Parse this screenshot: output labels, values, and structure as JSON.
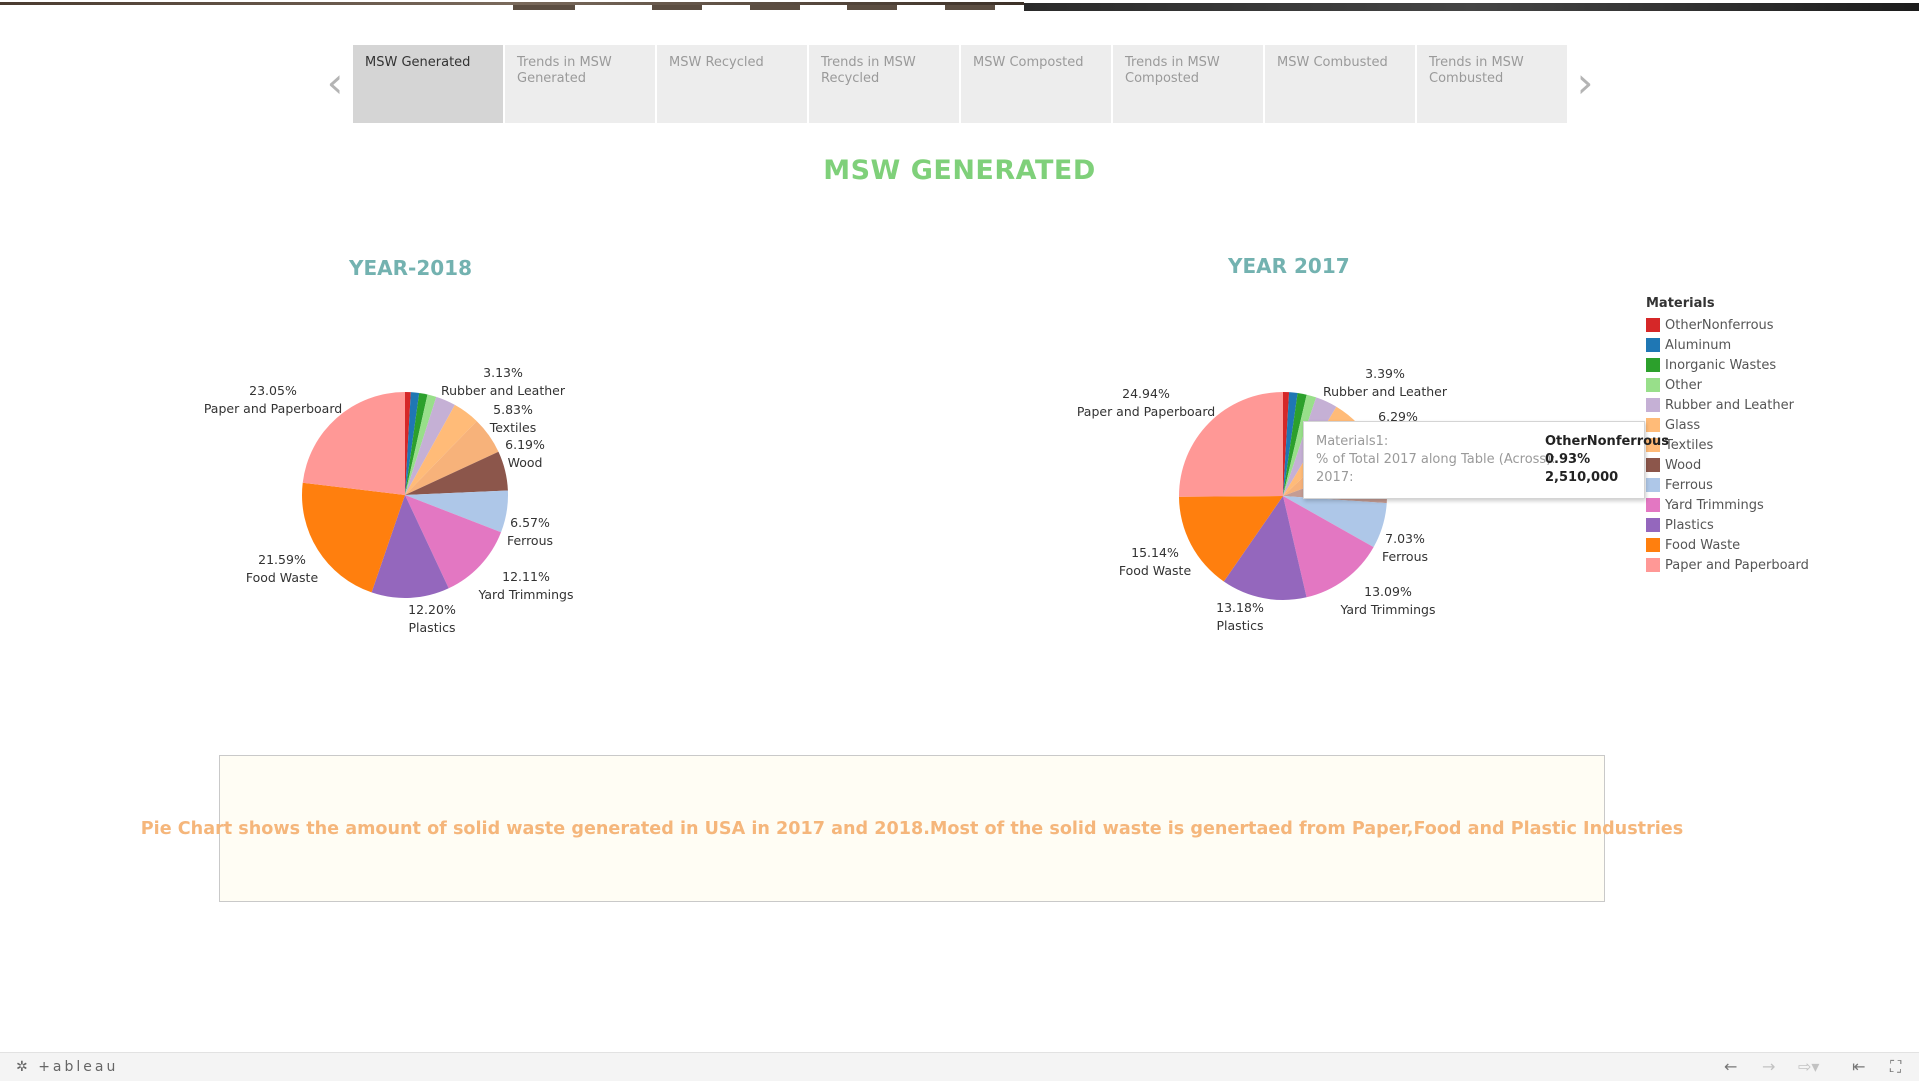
{
  "tabs": [
    {
      "label": "MSW Generated",
      "active": true
    },
    {
      "label": "Trends in MSW Generated",
      "active": false
    },
    {
      "label": "MSW Recycled",
      "active": false
    },
    {
      "label": "Trends in MSW Recycled",
      "active": false
    },
    {
      "label": "MSW Composted",
      "active": false
    },
    {
      "label": "Trends in MSW Composted",
      "active": false
    },
    {
      "label": "MSW Combusted",
      "active": false
    },
    {
      "label": "Trends in MSW Combusted",
      "active": false
    }
  ],
  "nav": {
    "prev_icon": "‹",
    "next_icon": "›"
  },
  "page_title": "MSW GENERATED",
  "chart_data": [
    {
      "type": "pie",
      "title": "YEAR-2018",
      "slices": [
        {
          "material": "OtherNonferrous",
          "percent": 0.9
        },
        {
          "material": "Aluminum",
          "percent": 1.3
        },
        {
          "material": "Inorganic Wastes",
          "percent": 1.3
        },
        {
          "material": "Other",
          "percent": 1.4
        },
        {
          "material": "Rubber and Leather",
          "percent": 3.13,
          "label": "3.13%"
        },
        {
          "material": "Glass",
          "percent": 4.2
        },
        {
          "material": "Textiles",
          "percent": 5.83,
          "label": "5.83%"
        },
        {
          "material": "Wood",
          "percent": 6.19,
          "label": "6.19%"
        },
        {
          "material": "Ferrous",
          "percent": 6.57,
          "label": "6.57%"
        },
        {
          "material": "Yard Trimmings",
          "percent": 12.11,
          "label": "12.11%"
        },
        {
          "material": "Plastics",
          "percent": 12.2,
          "label": "12.20%"
        },
        {
          "material": "Food Waste",
          "percent": 21.59,
          "label": "21.59%"
        },
        {
          "material": "Paper and Paperboard",
          "percent": 23.05,
          "label": "23.05%"
        }
      ]
    },
    {
      "type": "pie",
      "title": "YEAR 2017",
      "slices": [
        {
          "material": "OtherNonferrous",
          "percent": 0.93
        },
        {
          "material": "Aluminum",
          "percent": 1.3
        },
        {
          "material": "Inorganic Wastes",
          "percent": 1.4
        },
        {
          "material": "Other",
          "percent": 1.5
        },
        {
          "material": "Rubber and Leather",
          "percent": 3.39,
          "label": "3.39%"
        },
        {
          "material": "Glass",
          "percent": 4.4
        },
        {
          "material": "Textiles",
          "percent": 6.29,
          "label": "6.29%"
        },
        {
          "material": "Wood",
          "percent": 6.7
        },
        {
          "material": "Ferrous",
          "percent": 7.03,
          "label": "7.03%"
        },
        {
          "material": "Yard Trimmings",
          "percent": 13.09,
          "label": "13.09%"
        },
        {
          "material": "Plastics",
          "percent": 13.18,
          "label": "13.18%"
        },
        {
          "material": "Food Waste",
          "percent": 15.14,
          "label": "15.14%"
        },
        {
          "material": "Paper and Paperboard",
          "percent": 24.94,
          "label": "24.94%"
        }
      ]
    }
  ],
  "legend": {
    "title": "Materials",
    "items": [
      {
        "label": "OtherNonferrous",
        "color": "#d62728"
      },
      {
        "label": "Aluminum",
        "color": "#1f77b4"
      },
      {
        "label": "Inorganic Wastes",
        "color": "#2ca02c"
      },
      {
        "label": "Other",
        "color": "#98df8a"
      },
      {
        "label": "Rubber and Leather",
        "color": "#c5b0d5"
      },
      {
        "label": "Glass",
        "color": "#ffbb78"
      },
      {
        "label": "Textiles",
        "color": "#ffbb78"
      },
      {
        "label": "Wood",
        "color": "#8c564b"
      },
      {
        "label": "Ferrous",
        "color": "#aec7e8"
      },
      {
        "label": "Yard Trimmings",
        "color": "#e377c2"
      },
      {
        "label": "Plastics",
        "color": "#9467bd"
      },
      {
        "label": "Food Waste",
        "color": "#ff7f0e"
      },
      {
        "label": "Paper and Paperboard",
        "color": "#ff9896"
      }
    ]
  },
  "slice_colors": {
    "OtherNonferrous": "#d62728",
    "Aluminum": "#1f77b4",
    "Inorganic Wastes": "#2ca02c",
    "Other": "#98df8a",
    "Rubber and Leather": "#c5b0d5",
    "Glass": "#ffbb78",
    "Textiles": "#f7b27a",
    "Wood": "#8c564b",
    "Ferrous": "#aec7e8",
    "Yard Trimmings": "#e377c2",
    "Plastics": "#9467bd",
    "Food Waste": "#ff7f0e",
    "Paper and Paperboard": "#ff9896",
    "Wood_2017": "#c49c94"
  },
  "tooltip": {
    "rows": [
      {
        "key": "Materials1:",
        "value": "OtherNonferrous"
      },
      {
        "key": "% of Total 2017 along Table (Across):",
        "value": "0.93%"
      },
      {
        "key": "2017:",
        "value": "2,510,000"
      }
    ]
  },
  "description": "Pie Chart shows the amount of solid waste generated in USA in 2017 and 2018.Most of the solid waste is genertaed from Paper,Food and Plastic Industries",
  "footer": {
    "logo": "+ableau",
    "icons": [
      "undo-icon",
      "redo-icon",
      "share-icon",
      "revert-icon",
      "fullscreen-icon"
    ]
  }
}
